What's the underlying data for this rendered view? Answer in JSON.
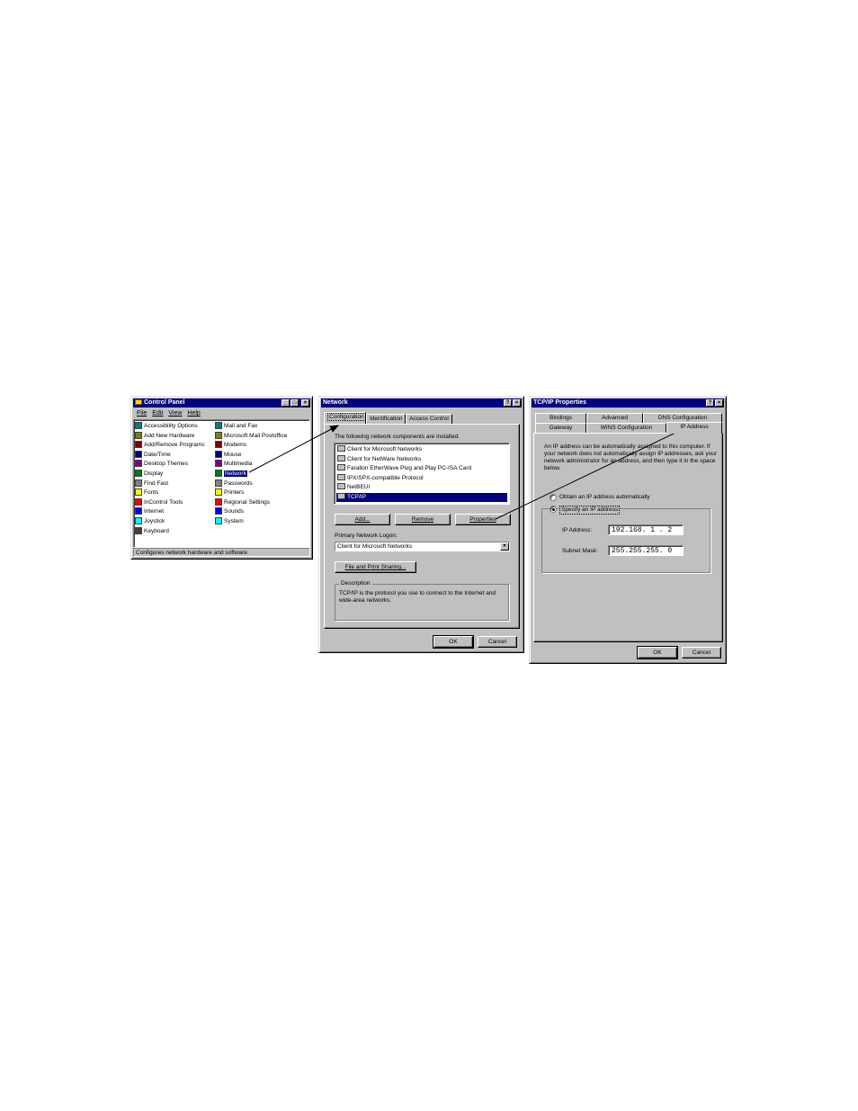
{
  "control_panel": {
    "title": "Control Panel",
    "menu": [
      "File",
      "Edit",
      "View",
      "Help"
    ],
    "items_left": [
      "Accessibility Options",
      "Add New Hardware",
      "Add/Remove Programs",
      "Date/Time",
      "Desktop Themes",
      "Display",
      "Find Fast",
      "Fonts",
      "InControl Tools",
      "Internet",
      "Joystick",
      "Keyboard"
    ],
    "items_right": [
      "Mail and Fax",
      "Microsoft Mail Postoffice",
      "Modems",
      "Mouse",
      "Multimedia",
      "Network",
      "Passwords",
      "Printers",
      "Regional Settings",
      "Sounds",
      "System"
    ],
    "selected": "Network",
    "status": "Configures network hardware and software."
  },
  "network": {
    "title": "Network",
    "tabs": [
      "Configuration",
      "Identification",
      "Access Control"
    ],
    "active_tab": "Configuration",
    "components_label": "The following network components are installed:",
    "components": [
      "Client for Microsoft Networks",
      "Client for NetWare Networks",
      "Farallon EtherWave Plug and Play PC-ISA Card",
      "IPX/SPX-compatible Protocol",
      "NetBEUI",
      "TCP/IP"
    ],
    "selected_component": "TCP/IP",
    "add_label": "Add...",
    "remove_label": "Remove",
    "properties_label": "Properties",
    "logon_label": "Primary Network Logon:",
    "logon_value": "Client for Microsoft Networks",
    "file_print_label": "File and Print Sharing...",
    "description_legend": "Description",
    "description_text": "TCP/IP is the protocol you use to connect to the Internet and wide-area networks.",
    "ok_label": "OK",
    "cancel_label": "Cancel"
  },
  "tcpip": {
    "title": "TCP/IP Properties",
    "tabs_row1": [
      "Bindings",
      "Advanced",
      "DNS Configuration"
    ],
    "tabs_row2": [
      "Gateway",
      "WINS Configuration",
      "IP Address"
    ],
    "active_tab": "IP Address",
    "explanation": "An IP address can be automatically assigned to this computer. If your network does not automatically assign IP addresses, ask your network administrator for an address, and then type it in the space below.",
    "radio_auto": "Obtain an IP address automatically",
    "radio_specify": "Specify an IP address",
    "radio_selected": "specify",
    "ip_label": "IP Address:",
    "ip_value": "192.168. 1 . 2",
    "mask_label": "Subnet Mask:",
    "mask_value": "255.255.255. 0",
    "ok_label": "OK",
    "cancel_label": "Cancel"
  },
  "icons": [
    "folder-icon",
    "control-panel-item-icon",
    "network-component-icon"
  ],
  "colors": {
    "titlebar": "#000080",
    "face": "#c0c0c0",
    "selection": "#000080"
  }
}
